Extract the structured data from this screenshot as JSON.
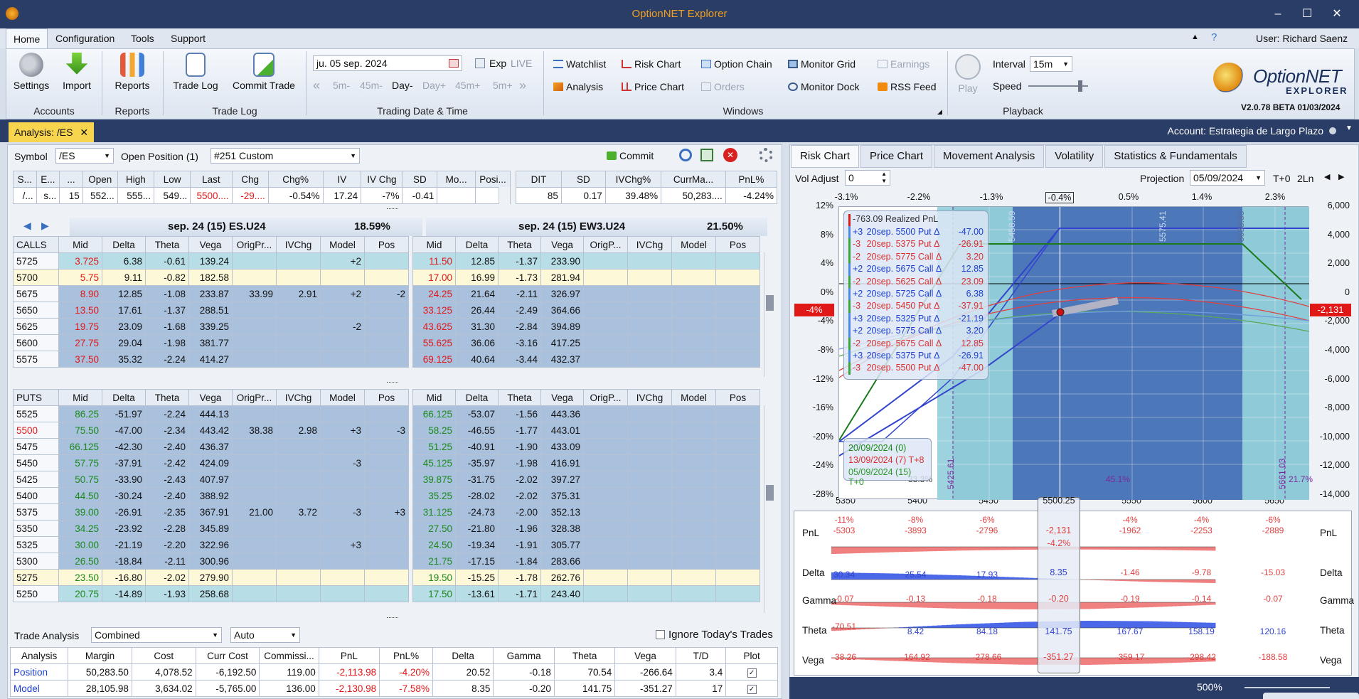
{
  "app": {
    "title": "OptionNET Explorer",
    "user": "User: Richard Saenz"
  },
  "menu": [
    "Home",
    "Configuration",
    "Tools",
    "Support"
  ],
  "ribbon": {
    "accounts": {
      "title": "Accounts",
      "settings": "Settings",
      "import": "Import"
    },
    "reports": {
      "title": "Reports",
      "reports": "Reports"
    },
    "tradelog": {
      "title": "Trade Log",
      "trade_log": "Trade Log",
      "commit_trade": "Commit Trade"
    },
    "trading": {
      "title": "Trading Date & Time",
      "date": "ju. 05 sep. 2024",
      "exp": "Exp",
      "live": "LIVE",
      "steps": [
        "5m-",
        "45m-",
        "Day-",
        "Day+",
        "45m+",
        "5m+"
      ]
    },
    "windows": {
      "title": "Windows",
      "watchlist": "Watchlist",
      "risk_chart": "Risk Chart",
      "option_chain": "Option Chain",
      "monitor_grid": "Monitor Grid",
      "earnings": "Earnings",
      "analysis": "Analysis",
      "price_chart": "Price Chart",
      "orders": "Orders",
      "monitor_dock": "Monitor Dock",
      "rss_feed": "RSS Feed"
    },
    "playback": {
      "title": "Playback",
      "play": "Play",
      "interval_label": "Interval",
      "interval": "15m",
      "speed_label": "Speed"
    },
    "logo": {
      "name": "OptionNET",
      "sub": "EXPLORER",
      "version": "V2.0.78 BETA 01/03/2024"
    }
  },
  "doc": {
    "tab": "Analysis: /ES",
    "account": "Account: Estrategia de Largo Plazo"
  },
  "left": {
    "symbol_label": "Symbol",
    "symbol": "/ES",
    "open_pos_label": "Open Position (1)",
    "position": "#251 Custom",
    "commit": "Commit",
    "quote_headers": [
      "S...",
      "E...",
      "...",
      "Open",
      "High",
      "Low",
      "Last",
      "Chg",
      "Chg%",
      "IV",
      "IV Chg",
      "SD",
      "Mo...",
      "Posi..."
    ],
    "quote_row": [
      "/...",
      "s...",
      "15",
      "552...",
      "555...",
      "549...",
      "5500....",
      "-29....",
      "-0.54%",
      "17.24",
      "-7%",
      "-0.41",
      "",
      ""
    ],
    "stats_headers": [
      "DIT",
      "SD",
      "IVChg%",
      "CurrMa...",
      "PnL%"
    ],
    "stats_row": [
      "85",
      "0.17",
      "39.48%",
      "50,283....",
      "-4.24%"
    ],
    "chain1": {
      "title": "sep. 24 (15)  ES.U24",
      "iv": "18.59%"
    },
    "chain2": {
      "title": "sep. 24 (15)  EW3.U24",
      "iv": "21.50%"
    },
    "calls_label": "CALLS",
    "puts_label": "PUTS",
    "cols1": [
      "Mid",
      "Delta",
      "Theta",
      "Vega",
      "OrigPr...",
      "IVChg",
      "Model",
      "Pos"
    ],
    "cols2": [
      "Mid",
      "Delta",
      "Theta",
      "Vega",
      "OrigP...",
      "IVChg",
      "Model",
      "Pos"
    ],
    "calls": [
      {
        "k": "5725",
        "s": "teal",
        "a": [
          "3.725",
          "6.38",
          "-0.61",
          "139.24",
          "",
          "",
          "+2",
          ""
        ],
        "b": [
          "11.50",
          "12.85",
          "-1.37",
          "233.90",
          "",
          "",
          "",
          ""
        ]
      },
      {
        "k": "5700",
        "s": "yel",
        "a": [
          "5.75",
          "9.11",
          "-0.82",
          "182.58",
          "",
          "",
          "",
          ""
        ],
        "b": [
          "17.00",
          "16.99",
          "-1.73",
          "281.94",
          "",
          "",
          "",
          ""
        ]
      },
      {
        "k": "5675",
        "s": "blue",
        "a": [
          "8.90",
          "12.85",
          "-1.08",
          "233.87",
          "33.99",
          "2.91",
          "+2",
          "-2"
        ],
        "b": [
          "24.25",
          "21.64",
          "-2.11",
          "326.97",
          "",
          "",
          "",
          ""
        ]
      },
      {
        "k": "5650",
        "s": "blue",
        "a": [
          "13.50",
          "17.61",
          "-1.37",
          "288.51",
          "",
          "",
          "",
          ""
        ],
        "b": [
          "33.125",
          "26.44",
          "-2.49",
          "364.66",
          "",
          "",
          "",
          ""
        ]
      },
      {
        "k": "5625",
        "s": "blue",
        "a": [
          "19.75",
          "23.09",
          "-1.68",
          "339.25",
          "",
          "",
          "-2",
          ""
        ],
        "b": [
          "43.625",
          "31.30",
          "-2.84",
          "394.89",
          "",
          "",
          "",
          ""
        ]
      },
      {
        "k": "5600",
        "s": "blue",
        "a": [
          "27.75",
          "29.04",
          "-1.98",
          "381.77",
          "",
          "",
          "",
          ""
        ],
        "b": [
          "55.625",
          "36.06",
          "-3.16",
          "417.25",
          "",
          "",
          "",
          ""
        ]
      },
      {
        "k": "5575",
        "s": "blue",
        "a": [
          "37.50",
          "35.32",
          "-2.24",
          "414.27",
          "",
          "",
          "",
          ""
        ],
        "b": [
          "69.125",
          "40.64",
          "-3.44",
          "432.37",
          "",
          "",
          "",
          ""
        ]
      }
    ],
    "puts": [
      {
        "k": "5525",
        "s": "blue",
        "a": [
          "86.25",
          "-51.97",
          "-2.24",
          "444.13",
          "",
          "",
          "",
          ""
        ],
        "b": [
          "66.125",
          "-53.07",
          "-1.56",
          "443.36",
          "",
          "",
          "",
          ""
        ]
      },
      {
        "k": "5500",
        "s": "blue",
        "a": [
          "75.50",
          "-47.00",
          "-2.34",
          "443.42",
          "38.38",
          "2.98",
          "+3",
          "-3"
        ],
        "b": [
          "58.25",
          "-46.55",
          "-1.77",
          "443.01",
          "",
          "",
          "",
          ""
        ]
      },
      {
        "k": "5475",
        "s": "blue",
        "a": [
          "66.125",
          "-42.30",
          "-2.40",
          "436.37",
          "",
          "",
          "",
          ""
        ],
        "b": [
          "51.25",
          "-40.91",
          "-1.90",
          "433.09",
          "",
          "",
          "",
          ""
        ]
      },
      {
        "k": "5450",
        "s": "blue",
        "a": [
          "57.75",
          "-37.91",
          "-2.42",
          "424.09",
          "",
          "",
          "-3",
          ""
        ],
        "b": [
          "45.125",
          "-35.97",
          "-1.98",
          "416.91",
          "",
          "",
          "",
          ""
        ]
      },
      {
        "k": "5425",
        "s": "blue",
        "a": [
          "50.75",
          "-33.90",
          "-2.43",
          "407.97",
          "",
          "",
          "",
          ""
        ],
        "b": [
          "39.875",
          "-31.75",
          "-2.02",
          "397.27",
          "",
          "",
          "",
          ""
        ]
      },
      {
        "k": "5400",
        "s": "blue",
        "a": [
          "44.50",
          "-30.24",
          "-2.40",
          "388.92",
          "",
          "",
          "",
          ""
        ],
        "b": [
          "35.25",
          "-28.02",
          "-2.02",
          "375.31",
          "",
          "",
          "",
          ""
        ]
      },
      {
        "k": "5375",
        "s": "blue",
        "a": [
          "39.00",
          "-26.91",
          "-2.35",
          "367.91",
          "21.00",
          "3.72",
          "-3",
          "+3"
        ],
        "b": [
          "31.125",
          "-24.73",
          "-2.00",
          "352.13",
          "",
          "",
          "",
          ""
        ]
      },
      {
        "k": "5350",
        "s": "blue",
        "a": [
          "34.25",
          "-23.92",
          "-2.28",
          "345.89",
          "",
          "",
          "",
          ""
        ],
        "b": [
          "27.50",
          "-21.80",
          "-1.96",
          "328.38",
          "",
          "",
          "",
          ""
        ]
      },
      {
        "k": "5325",
        "s": "blue",
        "a": [
          "30.00",
          "-21.19",
          "-2.20",
          "322.96",
          "",
          "",
          "+3",
          ""
        ],
        "b": [
          "24.50",
          "-19.34",
          "-1.91",
          "305.77",
          "",
          "",
          "",
          ""
        ]
      },
      {
        "k": "5300",
        "s": "blue",
        "a": [
          "26.50",
          "-18.84",
          "-2.11",
          "300.96",
          "",
          "",
          "",
          ""
        ],
        "b": [
          "21.75",
          "-17.15",
          "-1.84",
          "283.66",
          "",
          "",
          "",
          ""
        ]
      },
      {
        "k": "5275",
        "s": "yel",
        "a": [
          "23.50",
          "-16.80",
          "-2.02",
          "279.90",
          "",
          "",
          "",
          ""
        ],
        "b": [
          "19.50",
          "-15.25",
          "-1.78",
          "262.76",
          "",
          "",
          "",
          ""
        ]
      },
      {
        "k": "5250",
        "s": "teal",
        "a": [
          "20.75",
          "-14.89",
          "-1.93",
          "258.68",
          "",
          "",
          "",
          ""
        ],
        "b": [
          "17.50",
          "-13.61",
          "-1.71",
          "243.40",
          "",
          "",
          "",
          ""
        ]
      }
    ],
    "trade": {
      "label": "Trade Analysis",
      "mode": "Combined",
      "auto": "Auto",
      "ignore": "Ignore Today's Trades",
      "headers": [
        "Analysis",
        "Margin",
        "Cost",
        "Curr Cost",
        "Commissi...",
        "PnL",
        "PnL%",
        "Delta",
        "Gamma",
        "Theta",
        "Vega",
        "T/D",
        "Plot"
      ],
      "rows": [
        [
          "Position",
          "50,283.50",
          "4,078.52",
          "-6,192.50",
          "119.00",
          "-2,113.98",
          "-4.20%",
          "20.52",
          "-0.18",
          "70.54",
          "-266.64",
          "3.4"
        ],
        [
          "Model",
          "28,105.98",
          "3,634.02",
          "-5,765.00",
          "136.00",
          "-2,130.98",
          "-7.58%",
          "8.35",
          "-0.20",
          "141.75",
          "-351.27",
          "17"
        ]
      ]
    }
  },
  "right": {
    "tabs": [
      "Risk Chart",
      "Price Chart",
      "Movement Analysis",
      "Volatility",
      "Statistics & Fundamentals"
    ],
    "vol_label": "Vol Adjust",
    "vol": "0",
    "proj_label": "Projection",
    "proj": "05/09/2024",
    "tplus": "T+0",
    "lines": "2Ln",
    "top_pct": [
      "-3.1%",
      "-2.2%",
      "-1.3%",
      "-0.4%",
      "0.5%",
      "1.4%",
      "2.3%"
    ],
    "yleft": [
      "12%",
      "8%",
      "4%",
      "0%",
      "-4%",
      "-8%",
      "-12%",
      "-16%",
      "-20%",
      "-24%",
      "-28%",
      "-32%"
    ],
    "yright": [
      "6,000",
      "4,000",
      "2,000",
      "0",
      "-2,000",
      "-4,000",
      "-6,000",
      "-8,000",
      "-10,000",
      "-12,000",
      "-14,000",
      "-16,000"
    ],
    "xticks": [
      "5350",
      "5400",
      "5450",
      "5500.25",
      "5550",
      "5600",
      "5650"
    ],
    "left_marker": "-4%",
    "right_marker": "-2,131",
    "strike_labels": [
      "5458.59",
      "5575.41",
      "5638.83"
    ],
    "legend_title": "-763.09 Realized PnL",
    "legend": [
      {
        "q": "+3",
        "t": "20sep. 5500 Put Δ",
        "v": "-47.00",
        "c": "#1c3fd0"
      },
      {
        "q": "-3",
        "t": "20sep. 5375 Put Δ",
        "v": "-26.91",
        "c": "#d93030"
      },
      {
        "q": "-2",
        "t": "20sep. 5775 Call Δ",
        "v": "3.20",
        "c": "#d93030"
      },
      {
        "q": "+2",
        "t": "20sep. 5675 Call Δ",
        "v": "12.85",
        "c": "#1c3fd0"
      },
      {
        "q": "-2",
        "t": "20sep. 5625 Call Δ",
        "v": "23.09",
        "c": "#d93030"
      },
      {
        "q": "+2",
        "t": "20sep. 5725 Call Δ",
        "v": "6.38",
        "c": "#1c3fd0"
      },
      {
        "q": "-3",
        "t": "20sep. 5450 Put Δ",
        "v": "-37.91",
        "c": "#d93030"
      },
      {
        "q": "+3",
        "t": "20sep. 5325 Put Δ",
        "v": "-21.19",
        "c": "#1c3fd0"
      },
      {
        "q": "+2",
        "t": "20sep. 5775 Call Δ",
        "v": "3.20",
        "c": "#1c3fd0"
      },
      {
        "q": "-2",
        "t": "20sep. 5675 Call Δ",
        "v": "12.85",
        "c": "#d93030"
      },
      {
        "q": "+3",
        "t": "20sep. 5375 Put Δ",
        "v": "-26.91",
        "c": "#1c3fd0"
      },
      {
        "q": "-3",
        "t": "20sep. 5500 Put Δ",
        "v": "-47.00",
        "c": "#d93030"
      }
    ],
    "dates": [
      {
        "t": "20/09/2024 (0)",
        "c": "#1b8a1b"
      },
      {
        "t": "13/09/2024 (7) T+8",
        "c": "#d93030"
      },
      {
        "t": "05/09/2024 (15) T+0",
        "c": "#2e9a2e"
      }
    ],
    "band_labels": [
      "33.3%",
      "45.1%",
      "21.7%"
    ],
    "vlines": [
      "5425.61",
      "5661.03"
    ],
    "greeks": [
      {
        "n": "PnL",
        "top": [
          "-11%",
          "-8%",
          "-6%",
          "",
          "-4%",
          "-4%",
          "-6%"
        ],
        "v": [
          "-5303",
          "-3893",
          "-2796",
          "-2,131",
          "-1962",
          "-2253",
          "-2889"
        ],
        "extra": "-4.2%"
      },
      {
        "n": "Delta",
        "v": [
          "30.34",
          "25.54",
          "17.93",
          "8.35",
          "-1.46",
          "-9.78",
          "-15.03"
        ]
      },
      {
        "n": "Gamma",
        "v": [
          "-0.07",
          "-0.13",
          "-0.18",
          "-0.20",
          "-0.19",
          "-0.14",
          "-0.07"
        ]
      },
      {
        "n": "Theta",
        "v": [
          "-70.51",
          "8.42",
          "84.18",
          "141.75",
          "167.67",
          "158.19",
          "120.16"
        ]
      },
      {
        "n": "Vega",
        "v": [
          "-38.26",
          "-164.92",
          "-278.66",
          "-351.27",
          "-359.17",
          "-298.42",
          "-188.58"
        ]
      }
    ],
    "zoom": "500%"
  }
}
